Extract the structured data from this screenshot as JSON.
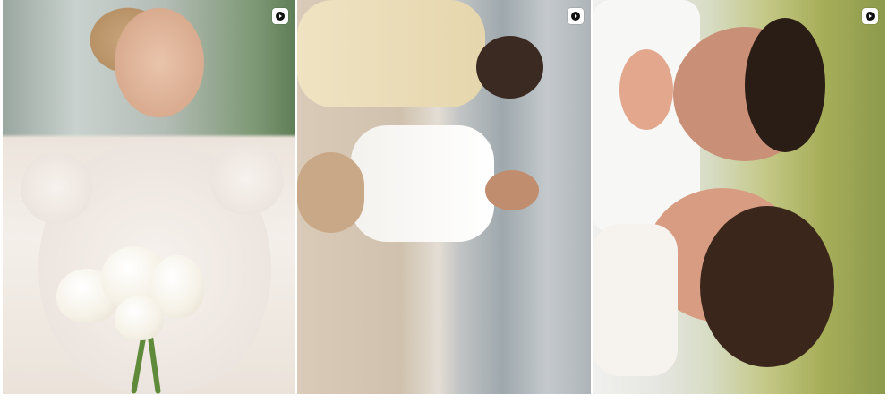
{
  "gallery": {
    "items": [
      {
        "media_type": "video",
        "icon": "play-icon",
        "subject": "bride-with-lilies"
      },
      {
        "media_type": "video",
        "icon": "play-icon",
        "subject": "couple-walking-on-beach"
      },
      {
        "media_type": "video",
        "icon": "play-icon",
        "subject": "couple-embracing-outdoors"
      }
    ]
  },
  "colors": {
    "background": "#ffffff",
    "play_badge": "#ffffff",
    "play_glyph": "#111111"
  }
}
